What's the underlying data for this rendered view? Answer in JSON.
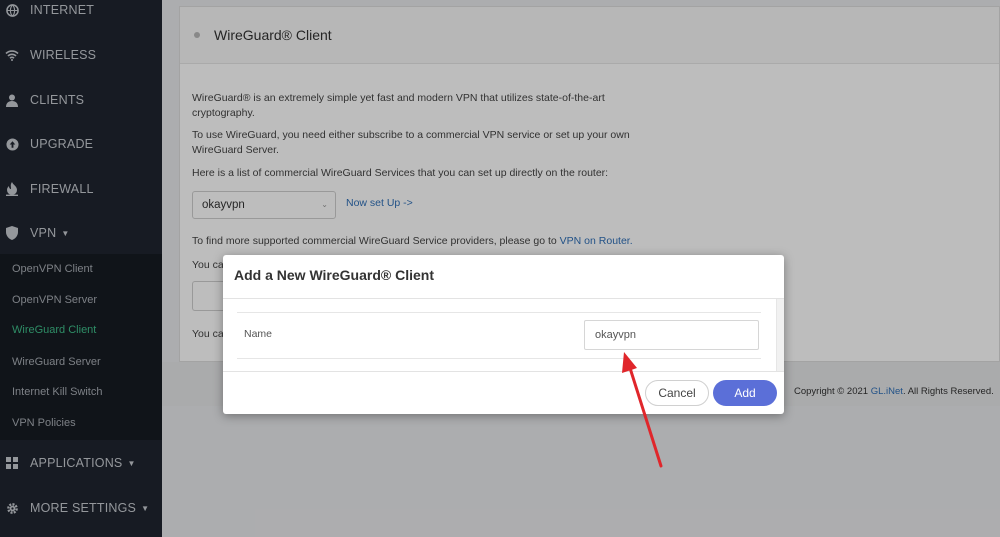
{
  "sidebar": {
    "items": [
      {
        "label": "INTERNET",
        "icon": "globe-icon"
      },
      {
        "label": "WIRELESS",
        "icon": "wifi-icon"
      },
      {
        "label": "CLIENTS",
        "icon": "user-icon"
      },
      {
        "label": "UPGRADE",
        "icon": "upgrade-icon"
      },
      {
        "label": "FIREWALL",
        "icon": "fire-icon"
      },
      {
        "label": "VPN",
        "icon": "shield-icon"
      },
      {
        "label": "APPLICATIONS",
        "icon": "grid-icon"
      },
      {
        "label": "MORE SETTINGS",
        "icon": "gear-icon"
      }
    ],
    "vpn_submenu": [
      "OpenVPN Client",
      "OpenVPN Server",
      "WireGuard Client",
      "WireGuard Server",
      "Internet Kill Switch",
      "VPN Policies"
    ],
    "active_color": "#3fbf8a"
  },
  "panel": {
    "title": "WireGuard® Client",
    "intro": "WireGuard® is an extremely simple yet fast and modern VPN that utilizes state-of-the-art cryptography.",
    "use_text": "To use WireGuard, you need either subscribe to a commercial VPN service or set up your own WireGuard Server.",
    "list_text": "Here is a list of commercial WireGuard Services that you can set up directly on the router:",
    "select_value": "okayvpn",
    "now_setup_link": "Now set Up ->",
    "providers_text": "To find more supported commercial WireGuard Service providers, please go to",
    "providers_link": "VPN on Router.",
    "you_can_1": "You ca",
    "you_can_2": "You ca"
  },
  "footer": {
    "copyright_prefix": "Copyright © 2021",
    "copyright_link": "GL.iNet",
    "copyright_suffix": ". All Rights Reserved."
  },
  "modal": {
    "title": "Add a New WireGuard® Client",
    "name_label": "Name",
    "name_value": "okayvpn",
    "cancel_label": "Cancel",
    "add_label": "Add",
    "add_color": "#5b6fd8"
  },
  "annotation": {
    "arrow_color": "#e0262b"
  }
}
